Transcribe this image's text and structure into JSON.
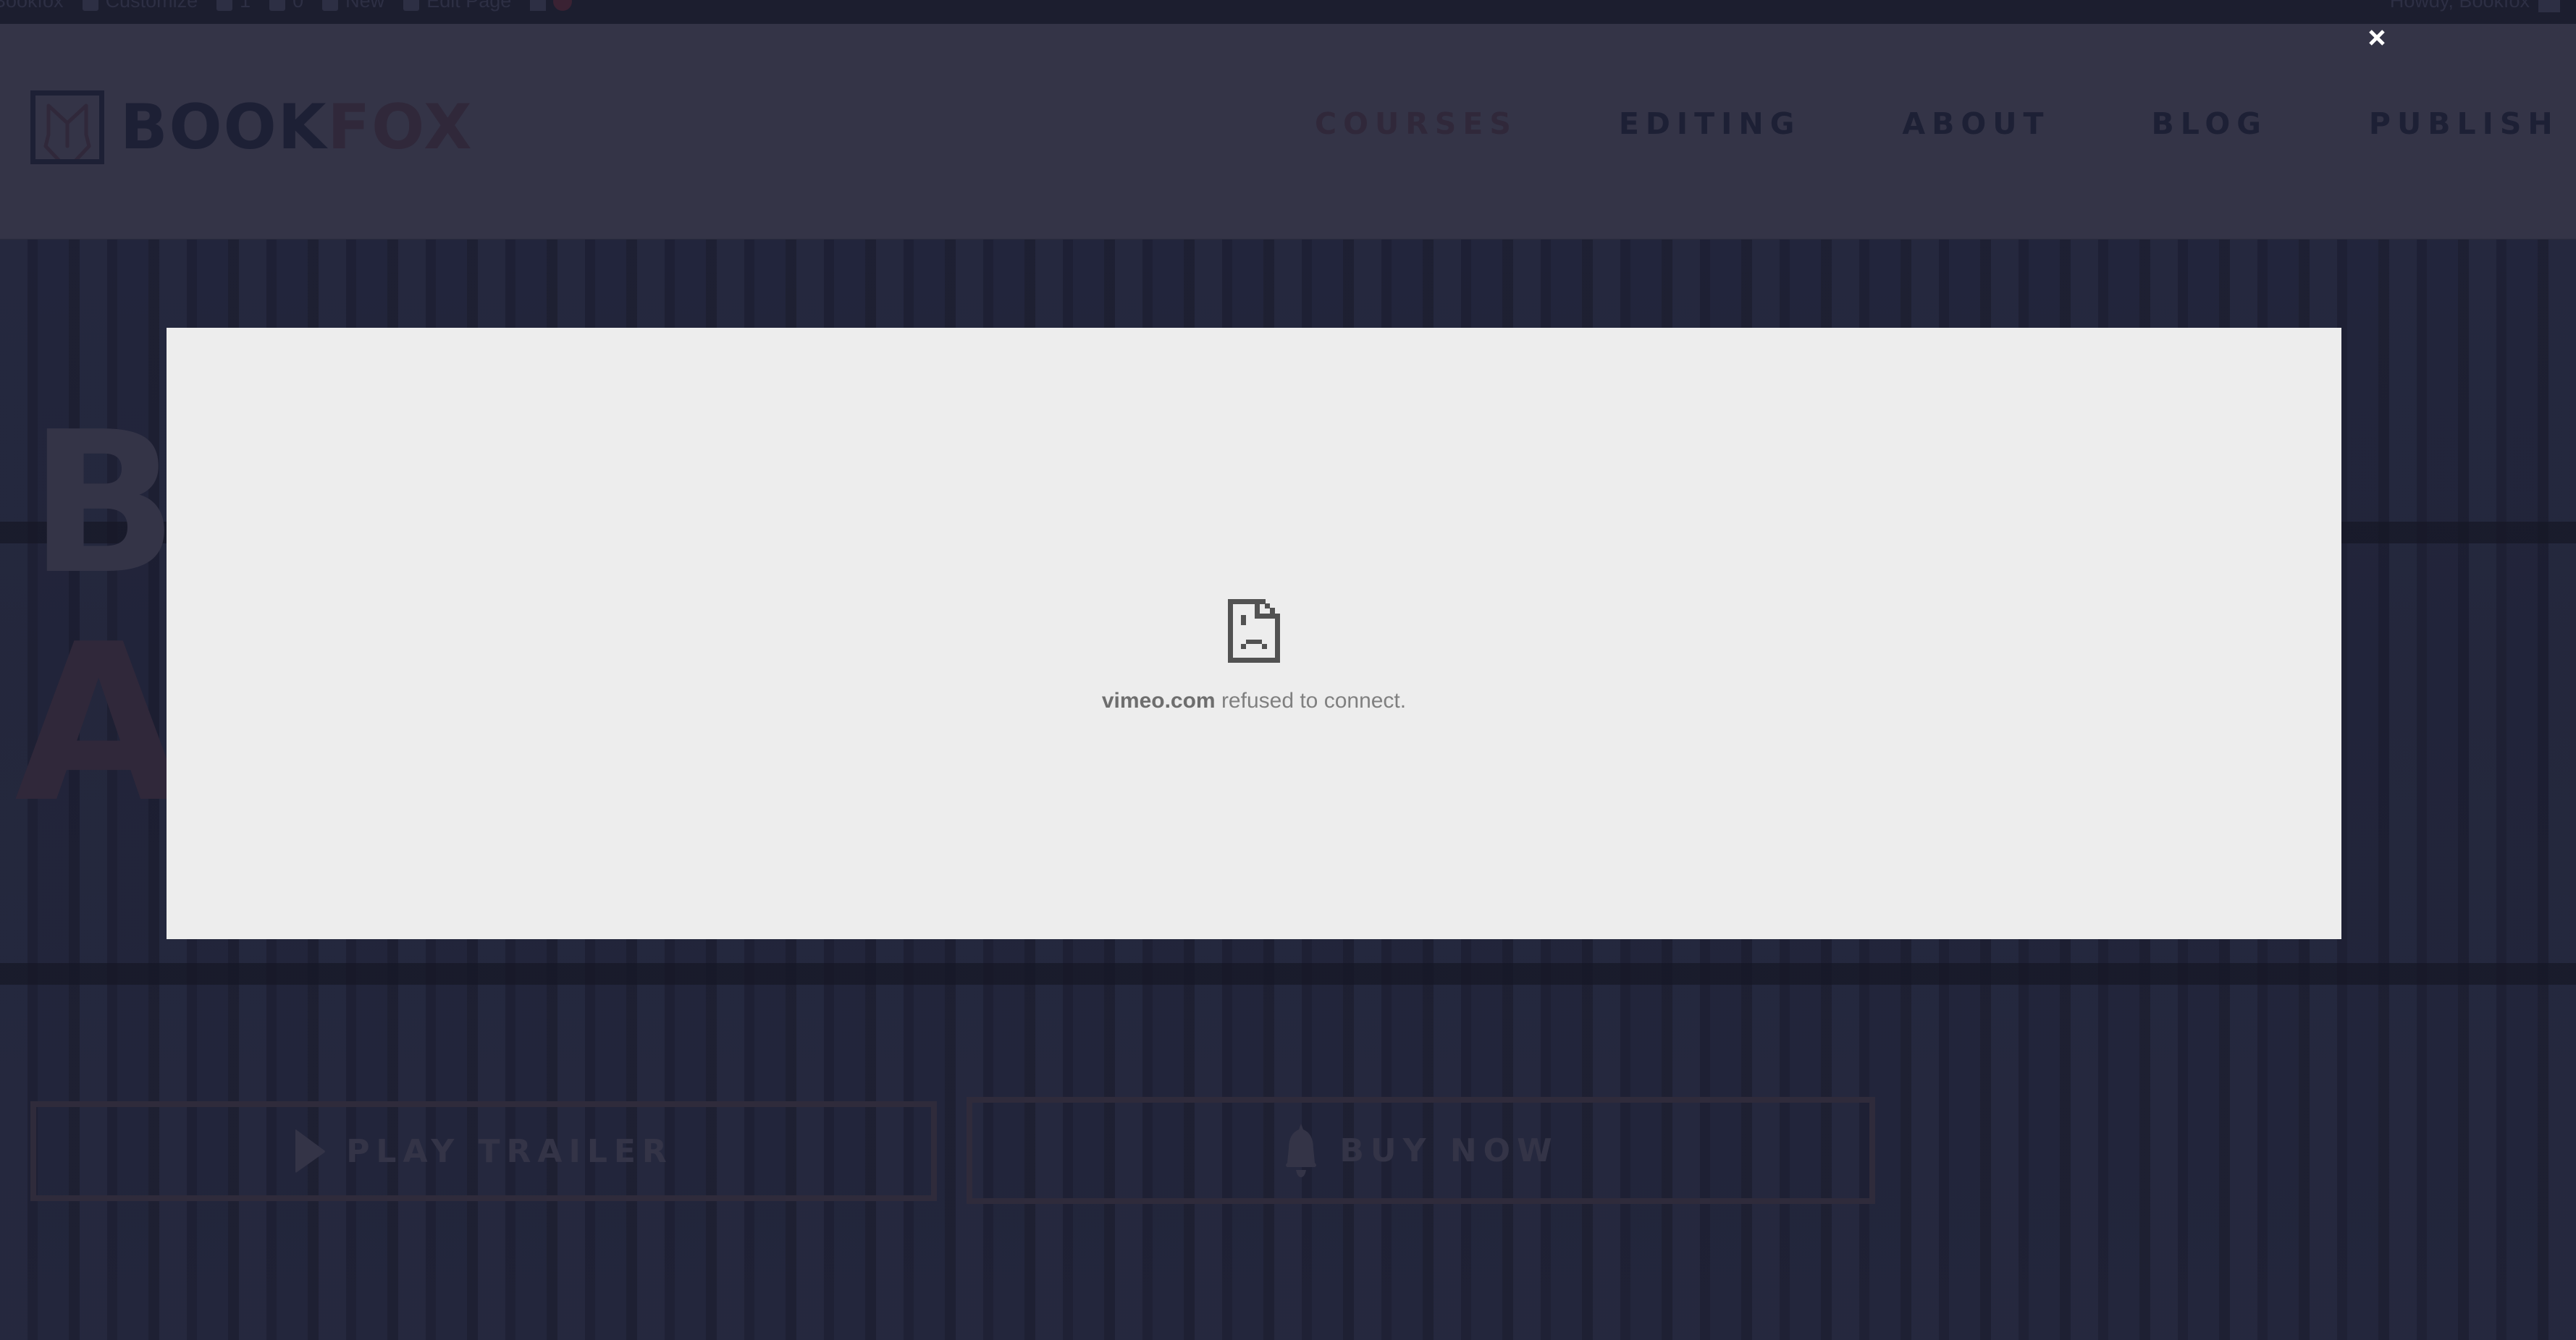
{
  "admin_bar": {
    "site_name": "Bookfox",
    "customize": "Customize",
    "updates_count": "1",
    "comments_count": "0",
    "new_label": "New",
    "edit_page": "Edit Page",
    "howdy": "Howdy, Bookfox"
  },
  "header": {
    "logo_part1": "BOOK",
    "logo_part2": "FOX",
    "nav": [
      {
        "label": "COURSES",
        "active": true
      },
      {
        "label": "EDITING",
        "active": false
      },
      {
        "label": "ABOUT",
        "active": false
      },
      {
        "label": "BLOG",
        "active": false
      },
      {
        "label": "PUBLISH",
        "active": false
      }
    ]
  },
  "hero": {
    "heading_letter_1": "B",
    "heading_letter_2": "A",
    "play_trailer": "PLAY TRAILER",
    "buy_now": "BUY NOW"
  },
  "modal": {
    "close_icon": "close-icon",
    "error_domain": "vimeo.com",
    "error_text": " refused to connect."
  },
  "colors": {
    "header_bg": "#343447",
    "page_bg": "#21233a",
    "brand_dark": "#1d2035",
    "brand_accent": "#30283a",
    "modal_bg": "#ededed"
  }
}
